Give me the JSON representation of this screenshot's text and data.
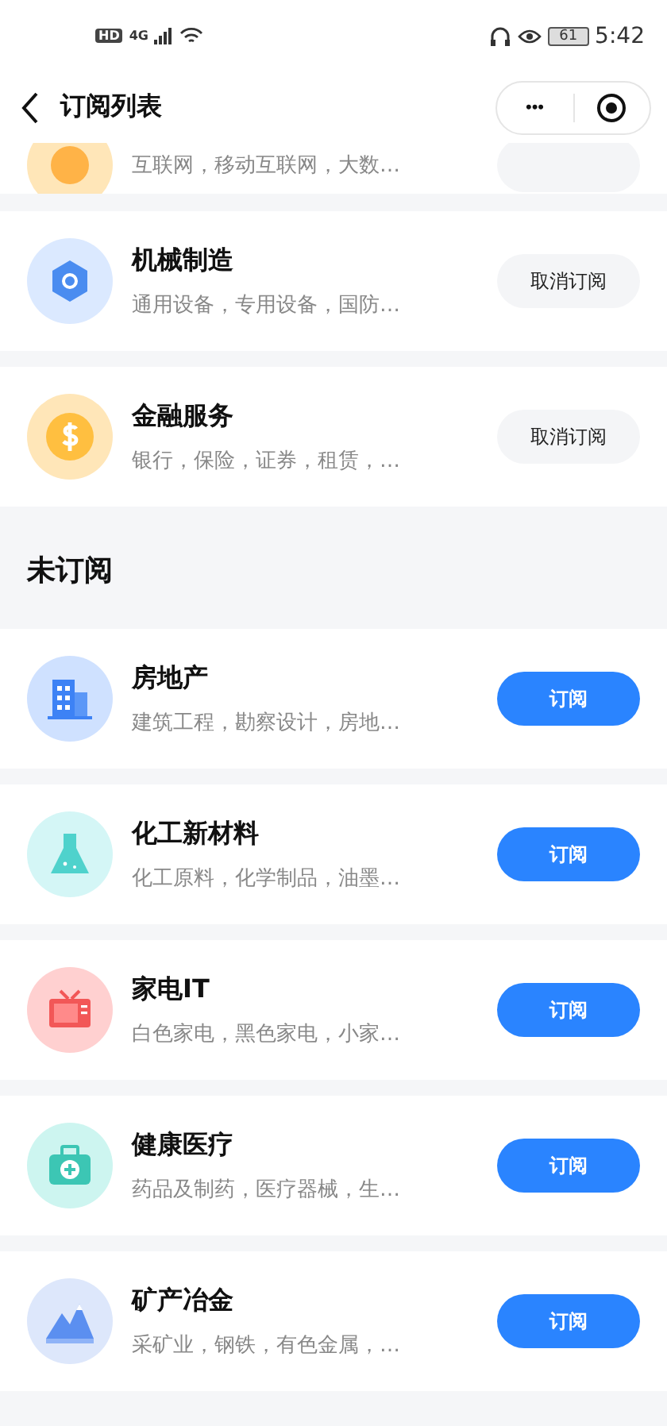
{
  "status_bar": {
    "hd": "HD",
    "network": "4G",
    "battery": "61",
    "time": "5:42"
  },
  "nav": {
    "title": "订阅列表",
    "more": "•••"
  },
  "subscribed": {
    "items": [
      {
        "kind": "internet",
        "subtitle": "互联网，移动互联网，大数…",
        "subscribed": true,
        "clipped": true
      },
      {
        "kind": "gear",
        "title": "机械制造",
        "subtitle": "通用设备，专用设备，国防…",
        "button": "取消订阅",
        "subscribed": true,
        "clipped": false
      },
      {
        "kind": "coin",
        "title": "金融服务",
        "subtitle": "银行，保险，证券，租赁，…",
        "button": "取消订阅",
        "subscribed": true,
        "clipped": false
      }
    ]
  },
  "unsubscribed": {
    "heading": "未订阅",
    "items": [
      {
        "kind": "building",
        "title": "房地产",
        "subtitle": "建筑工程，勘察设计，房地…",
        "button": "订阅",
        "subscribed": false
      },
      {
        "kind": "flask",
        "title": "化工新材料",
        "subtitle": "化工原料，化学制品，油墨…",
        "button": "订阅",
        "subscribed": false
      },
      {
        "kind": "tv",
        "title": "家电IT",
        "subtitle": "白色家电，黑色家电，小家…",
        "button": "订阅",
        "subscribed": false
      },
      {
        "kind": "medkit",
        "title": "健康医疗",
        "subtitle": "药品及制药，医疗器械，生…",
        "button": "订阅",
        "subscribed": false
      },
      {
        "kind": "mountain",
        "title": "矿产冶金",
        "subtitle": "采矿业，钢铁，有色金属，…",
        "button": "订阅",
        "subscribed": false
      }
    ]
  }
}
